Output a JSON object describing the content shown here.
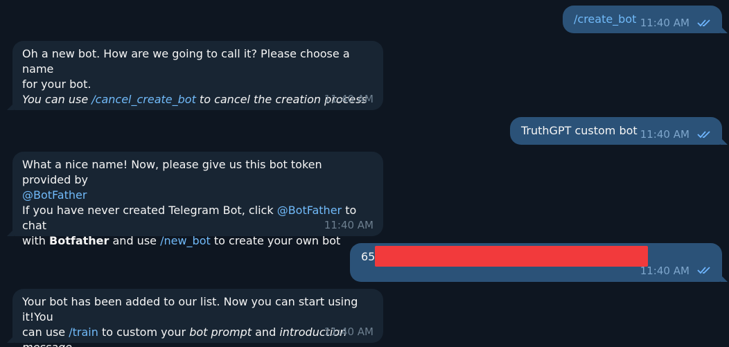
{
  "messages": {
    "m1": {
      "text": "/create_bot",
      "time": "11:40 AM"
    },
    "m2": {
      "line1": "Oh a new bot. How are we going to call it? Please choose a name",
      "line2": "for your bot.",
      "line3_pre": "You can use ",
      "line3_cmd": "/cancel_create_bot",
      "line3_post": " to cancel the creation process",
      "time": "11:40 AM"
    },
    "m3": {
      "text": "TruthGPT custom bot",
      "time": "11:40 AM"
    },
    "m4": {
      "line1": "What a nice name! Now, please give us this bot token provided by",
      "line2_mention": "@BotFather",
      "line3_pre": "If you have never created Telegram Bot, click ",
      "line3_mention": "@BotFather",
      "line3_post": " to chat",
      "line4_pre": "with ",
      "line4_bold": "Botfather",
      "line4_mid": " and use ",
      "line4_cmd": "/new_bot",
      "line4_post": " to create your own bot",
      "time": "11:40 AM"
    },
    "m5": {
      "token_prefix": "65",
      "time": "11:40 AM"
    },
    "m6": {
      "line1": "Your bot has been added to our list. Now you can start using it!You",
      "line2_pre": "can use ",
      "line2_cmd": "/train",
      "line2_mid": " to custom your ",
      "line2_it1": "bot prompt",
      "line2_and": " and ",
      "line2_it2": "introduction message",
      "time": "11:40 AM"
    }
  },
  "colors": {
    "background": "#0e1621",
    "incoming_bubble": "#182533",
    "outgoing_bubble": "#2b5278",
    "link": "#71baf9",
    "redaction": "#f23a3c"
  },
  "icons": {
    "read_status": "double-check-icon"
  }
}
